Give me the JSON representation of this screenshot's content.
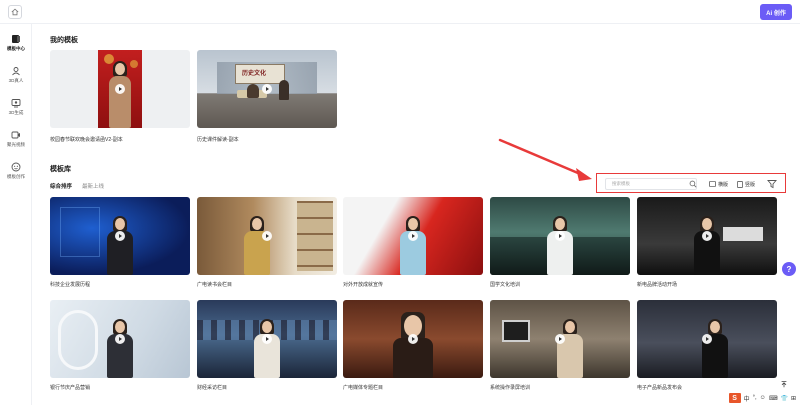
{
  "topbar": {
    "ai_button_label": "Ai 创作"
  },
  "sidebar": {
    "items": [
      {
        "label": "模板中心",
        "icon": "template-icon"
      },
      {
        "label": "3D真人",
        "icon": "person-icon"
      },
      {
        "label": "3D生成",
        "icon": "generate-icon"
      },
      {
        "label": "聚光视频",
        "icon": "video-icon"
      },
      {
        "label": "模板创作",
        "icon": "create-icon"
      }
    ]
  },
  "my_templates": {
    "title": "我的模板",
    "items": [
      {
        "name": "校园春节联欢晚会邀请函V2-副本"
      },
      {
        "name": "历史课件解读-副本"
      }
    ]
  },
  "library": {
    "title": "模板库",
    "sort_tabs": [
      "综合排序",
      "最新上线"
    ],
    "search_placeholder": "搜索模板",
    "horizontal_label": "横版",
    "vertical_label": "竖版",
    "rows": [
      [
        {
          "name": "科技企业发展历程"
        },
        {
          "name": "广电读书会栏目"
        },
        {
          "name": "对外开放成就宣传"
        },
        {
          "name": "国学文化培训"
        },
        {
          "name": "新电品牌活动开场"
        }
      ],
      [
        {
          "name": "银行节庆产品营销"
        },
        {
          "name": "财经采访栏目"
        },
        {
          "name": "广电媒体专题栏目"
        },
        {
          "name": "系统操作录屏培训"
        },
        {
          "name": "电子产品新品发布会"
        }
      ]
    ]
  },
  "ime": {
    "items": [
      "中",
      "°,",
      "☺",
      "⌨",
      "👕",
      "⊞"
    ]
  },
  "colors": {
    "accent": "#6b5cf6",
    "highlight": "#e83a3a"
  }
}
